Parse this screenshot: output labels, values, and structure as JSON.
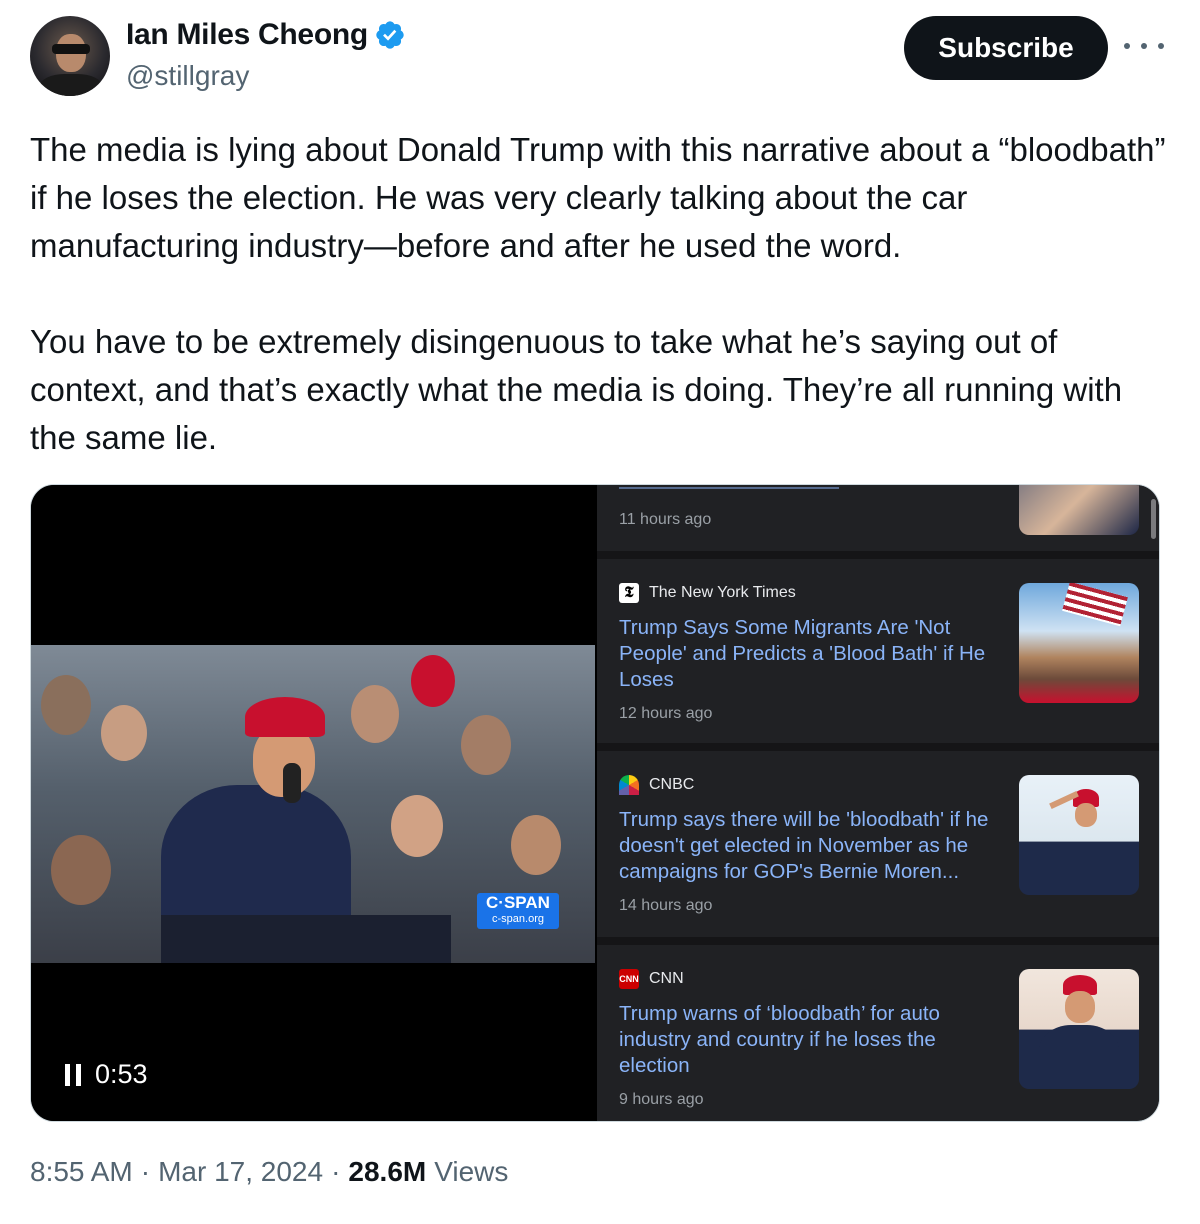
{
  "author": {
    "display_name": "Ian Miles Cheong",
    "handle": "@stillgray",
    "verified": true
  },
  "actions": {
    "subscribe_label": "Subscribe"
  },
  "tweet": {
    "text": "The media is lying about Donald Trump with this narrative about a “bloodbath” if he loses the election. He was very clearly talking about the car manufacturing industry—before and after he used the word.\n\nYou have to be extremely disingenuous to take what he’s saying out of context, and that’s exactly what the media is doing. They’re all running with the same lie."
  },
  "video": {
    "elapsed": "0:53",
    "watermark_line1": "C·SPAN",
    "watermark_line2": "c-span.org",
    "state": "playing"
  },
  "news_panel": {
    "top_partial": {
      "time": "11 hours ago"
    },
    "items": [
      {
        "source": "The New York Times",
        "source_icon": "nyt-icon",
        "headline": "Trump Says Some Migrants Are 'Not People' and Predicts a 'Blood Bath' if He Loses",
        "time": "12 hours ago"
      },
      {
        "source": "CNBC",
        "source_icon": "cnbc-icon",
        "headline": "Trump says there will be 'bloodbath' if he doesn't get elected in November as he campaigns for GOP's Bernie Moren...",
        "time": "14 hours ago"
      },
      {
        "source": "CNN",
        "source_icon": "cnn-icon",
        "headline": "Trump warns of ‘bloodbath’ for auto industry and country if he loses the election",
        "time": "9 hours ago"
      }
    ]
  },
  "meta": {
    "time": "8:55 AM",
    "date": "Mar 17, 2024",
    "separator": "·",
    "views_count": "28.6M",
    "views_label": "Views"
  },
  "colors": {
    "text_primary": "#0f1419",
    "text_secondary": "#536471",
    "verified_blue": "#1d9bf0",
    "news_link": "#8ab4f8",
    "news_bg": "#202124"
  }
}
